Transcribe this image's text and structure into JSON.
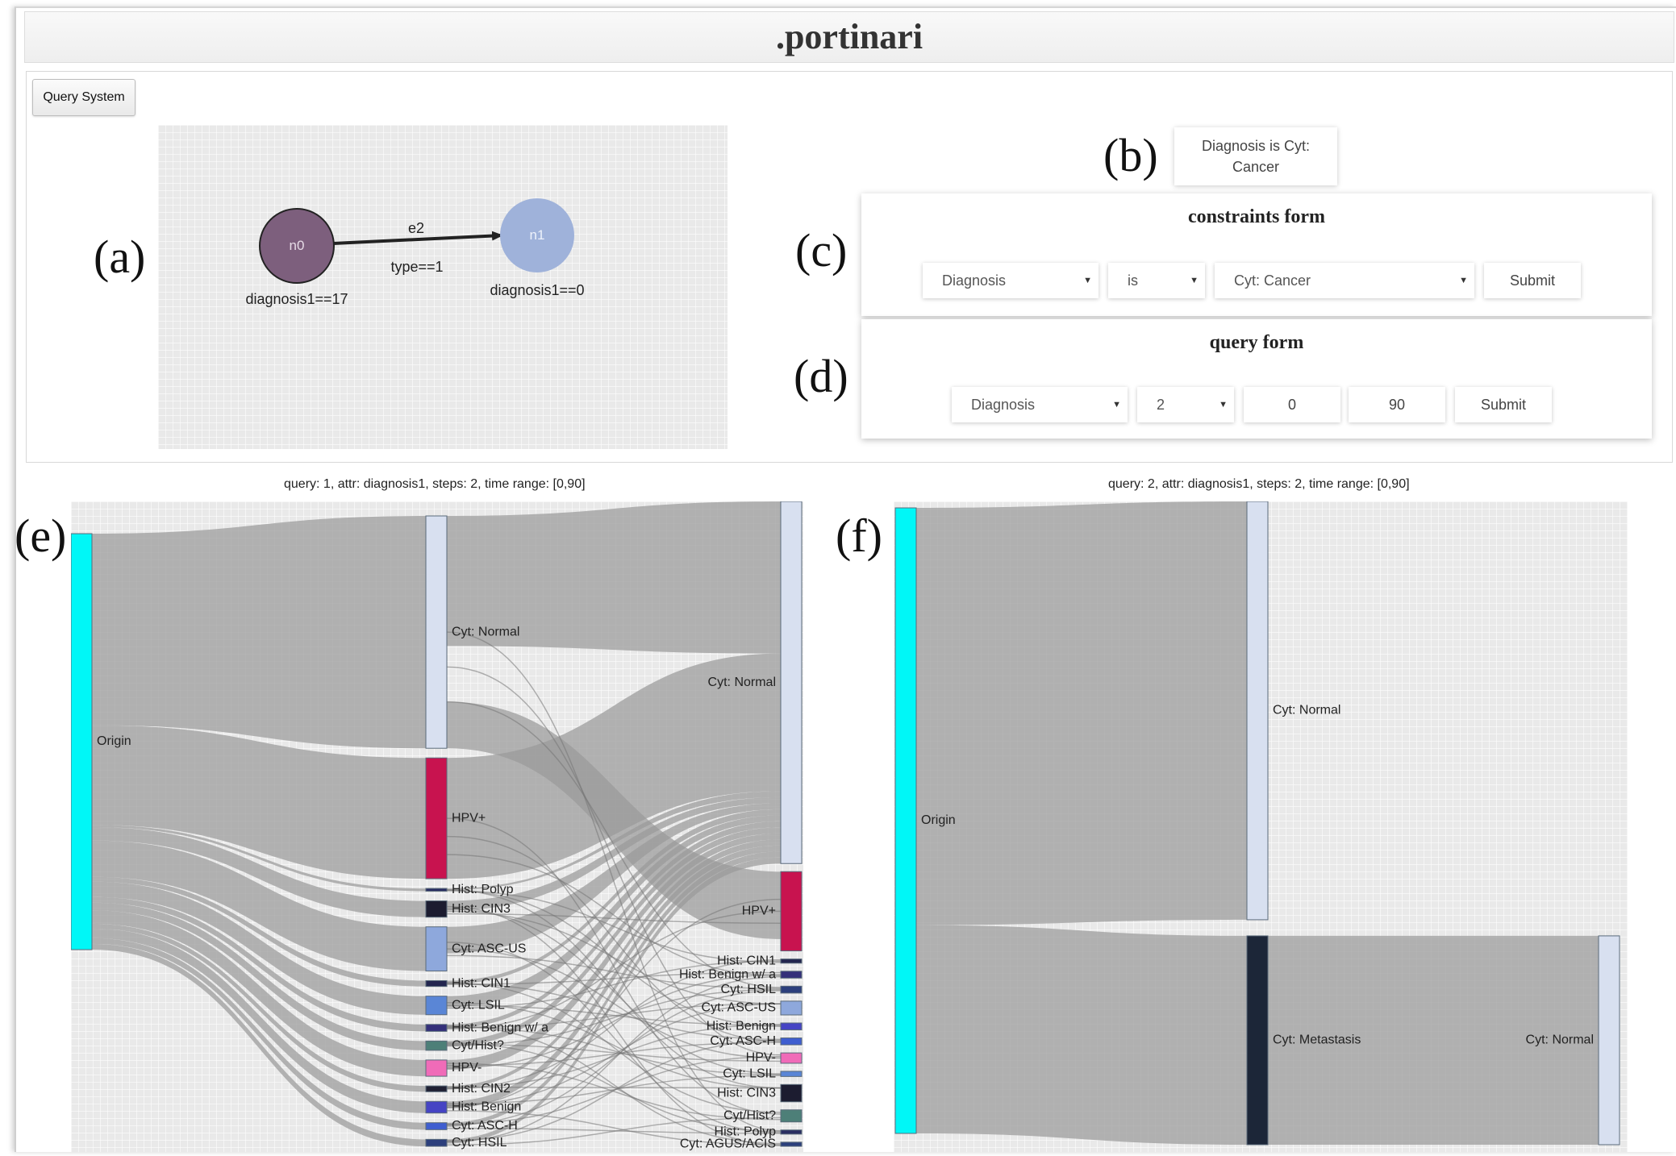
{
  "app": {
    "title": ".portinari"
  },
  "toolbar": {
    "query_system_label": "Query System"
  },
  "panel_letters": {
    "a": "(a)",
    "b": "(b)",
    "c": "(c)",
    "d": "(d)",
    "e": "(e)",
    "f": "(f)"
  },
  "graph": {
    "nodes": [
      {
        "id": "n0",
        "label": "diagnosis1==17",
        "color": "#7d5f7d"
      },
      {
        "id": "n1",
        "label": "diagnosis1==0",
        "color": "#9fb2da"
      }
    ],
    "edge": {
      "id": "e2",
      "condition": "type==1"
    }
  },
  "diagnosis_box": {
    "line1": "Diagnosis is Cyt:",
    "line2": "Cancer"
  },
  "constraints_form": {
    "title": "constraints form",
    "attribute": "Diagnosis",
    "operator": "is",
    "value": "Cyt: Cancer",
    "submit_label": "Submit"
  },
  "query_form": {
    "title": "query form",
    "attribute": "Diagnosis",
    "steps": "2",
    "time_start": "0",
    "time_end": "90",
    "submit_label": "Submit"
  },
  "chart_data": [
    {
      "type": "sankey",
      "title": "query: 1, attr: diagnosis1, steps: 2, time range: [0,90]",
      "source": {
        "name": "Origin",
        "color": "#00f7f7"
      },
      "step1": [
        {
          "name": "Cyt: Normal",
          "color": "#d8e0f0",
          "value": 100
        },
        {
          "name": "HPV+",
          "color": "#c8134f",
          "value": 52
        },
        {
          "name": "Hist: Polyp",
          "color": "#2a2e62",
          "value": 1.2
        },
        {
          "name": "Hist: CIN3",
          "color": "#1c1c30",
          "value": 7
        },
        {
          "name": "Cyt: ASC-US",
          "color": "#8ea8dc",
          "value": 19
        },
        {
          "name": "Hist: CIN1",
          "color": "#23264f",
          "value": 2.5
        },
        {
          "name": "Cyt: LSIL",
          "color": "#5a86d6",
          "value": 8
        },
        {
          "name": "Hist: Benign w/ a",
          "color": "#34307a",
          "value": 3
        },
        {
          "name": "Cyt/Hist?",
          "color": "#4d7f78",
          "value": 4
        },
        {
          "name": "HPV-",
          "color": "#f06bb8",
          "value": 7
        },
        {
          "name": "Hist: CIN2",
          "color": "#1f2033",
          "value": 2.5
        },
        {
          "name": "Hist: Benign",
          "color": "#4644c4",
          "value": 5
        },
        {
          "name": "Cyt: ASC-H",
          "color": "#3f5ed0",
          "value": 3
        },
        {
          "name": "Cyt: HSIL",
          "color": "#2c3f7c",
          "value": 3
        }
      ],
      "step2": [
        {
          "name": "Cyt: Normal",
          "color": "#d8e0f0",
          "value": 105
        },
        {
          "name": "HPV+",
          "color": "#c8134f",
          "value": 23
        },
        {
          "name": "Hist: CIN1",
          "color": "#23264f",
          "value": 1.2
        },
        {
          "name": "Hist: Benign w/ a",
          "color": "#34307a",
          "value": 2
        },
        {
          "name": "Cyt: HSIL",
          "color": "#2c3f7c",
          "value": 2
        },
        {
          "name": "Cyt: ASC-US",
          "color": "#8ea8dc",
          "value": 4
        },
        {
          "name": "Hist: Benign",
          "color": "#4644c4",
          "value": 2
        },
        {
          "name": "Cyt: ASC-H",
          "color": "#3f5ed0",
          "value": 2
        },
        {
          "name": "HPV-",
          "color": "#f06bb8",
          "value": 3
        },
        {
          "name": "Cyt: LSIL",
          "color": "#5a86d6",
          "value": 1.5
        },
        {
          "name": "Hist: CIN3",
          "color": "#1c1c30",
          "value": 5
        },
        {
          "name": "Cyt/Hist?",
          "color": "#4d7f78",
          "value": 3.5
        },
        {
          "name": "Hist: Polyp",
          "color": "#2a2e62",
          "value": 1.2
        },
        {
          "name": "Cyt: AGUS/ACIS",
          "color": "#2c3f7c",
          "value": 1.2
        }
      ]
    },
    {
      "type": "sankey",
      "title": "query: 2, attr: diagnosis1, steps: 2, time range: [0,90]",
      "source": {
        "name": "Origin",
        "color": "#00f7f7"
      },
      "step1": [
        {
          "name": "Cyt: Normal",
          "color": "#d8e0f0",
          "value": 66.7
        },
        {
          "name": "Cyt: Metastasis",
          "color": "#1c2638",
          "value": 33.3
        }
      ],
      "step2": [
        {
          "name": "Cyt: Normal",
          "color": "#d8e0f0",
          "value": 33.3
        }
      ],
      "links": [
        {
          "from": "Origin",
          "to": "Cyt: Normal",
          "value": 66.7
        },
        {
          "from": "Origin",
          "to": "Cyt: Metastasis",
          "value": 33.3
        },
        {
          "from": "Cyt: Metastasis",
          "to": "Cyt: Normal",
          "value": 33.3
        }
      ]
    }
  ]
}
